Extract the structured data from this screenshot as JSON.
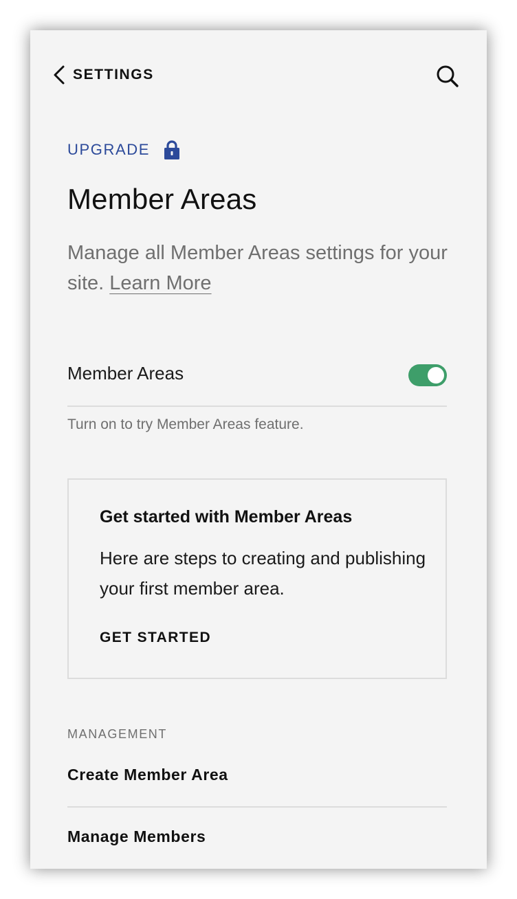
{
  "topbar": {
    "back_label": "SETTINGS",
    "back_icon": "chevron-left-icon",
    "search_icon": "search-icon"
  },
  "upgrade": {
    "label": "UPGRADE",
    "icon": "lock-icon",
    "color": "#2c4a9a"
  },
  "page": {
    "title": "Member Areas",
    "description": "Manage all Member Areas settings for your site.",
    "learn_more": "Learn More"
  },
  "member_areas_toggle": {
    "label": "Member Areas",
    "state": "on",
    "color": "#3e9e6a",
    "hint": "Turn on to try Member Areas feature."
  },
  "get_started_card": {
    "title": "Get started with Member Areas",
    "body": "Here are steps to creating and publishing your first member area.",
    "cta": "GET STARTED"
  },
  "management": {
    "section_label": "MANAGEMENT",
    "items": [
      {
        "label": "Create Member Area"
      },
      {
        "label": "Manage Members"
      }
    ]
  }
}
